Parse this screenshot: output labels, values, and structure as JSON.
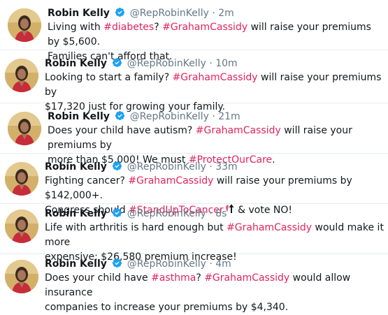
{
  "colors": {
    "hashtag": "#e0245e",
    "verified": "#1da1f2",
    "name": "#14171a",
    "meta": "#657786"
  },
  "tweets": [
    {
      "name": "Robin Kelly",
      "handle": "@RepRobinKelly",
      "dot": "·",
      "time": "2m",
      "line1": [
        "Living with ",
        "#diabetes",
        "? ",
        "#GrahamCassidy",
        " will raise your premiums by $5,600."
      ],
      "line2": [
        "Families can't afford that."
      ]
    },
    {
      "name": "Robin Kelly",
      "handle": "@RepRobinKelly",
      "dot": "·",
      "time": "10m",
      "line1": [
        "Looking to start a family? ",
        "#GrahamCassidy",
        " will raise your premiums by"
      ],
      "line2": [
        "$17,320 just for growing your family."
      ]
    },
    {
      "name": "Robin Kelly",
      "handle": "@RepRobinKelly",
      "dot": "·",
      "time": "21m",
      "line1": [
        "Does your child have autism? ",
        "#GrahamCassidy",
        " will raise your premiums by"
      ],
      "line2": [
        "more than $5,000! We must ",
        "#ProtectOurCare",
        "."
      ]
    },
    {
      "name": "Robin Kelly",
      "handle": "@RepRobinKelly",
      "dot": "·",
      "time": "33m",
      "line1": [
        "Fighting cancer? ",
        "#GrahamCassidy",
        " will raise your premiums by $142,000+."
      ],
      "line2": [
        "Congress should ",
        "#StandUpToCancer",
        " & vote NO!"
      ]
    },
    {
      "name": "Robin Kelly",
      "handle": "@RepRobinKelly",
      "dot": "·",
      "time": "8s",
      "line1": [
        "Life with arthritis is hard enough but ",
        "#GrahamCassidy",
        " would make it more"
      ],
      "line2": [
        "expensive: $26,580 premium increase!"
      ]
    },
    {
      "name": "Robin Kelly",
      "handle": "@RepRobinKelly",
      "dot": "·",
      "time": "4m",
      "line1": [
        "Does your child have ",
        "#asthma",
        "? ",
        "#GrahamCassidy",
        " would allow insurance"
      ],
      "line2": [
        "companies to increase your premiums by $4,340."
      ]
    }
  ]
}
